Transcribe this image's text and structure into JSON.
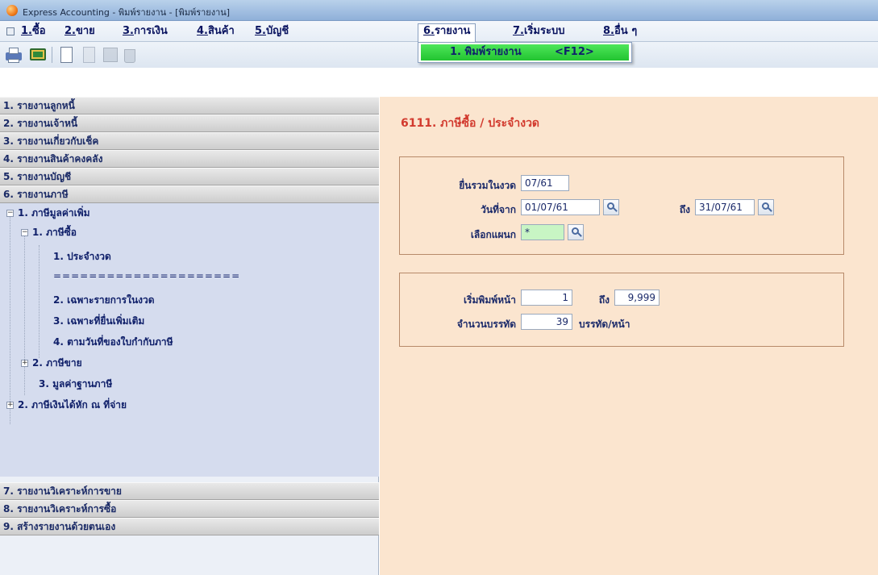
{
  "window": {
    "title": "Express Accounting - พิมพ์รายงาน - [พิมพ์รายงาน]"
  },
  "menu": {
    "items": [
      {
        "num": "1.",
        "label": "ซื้อ"
      },
      {
        "num": "2.",
        "label": "ขาย"
      },
      {
        "num": "3.",
        "label": "การเงิน"
      },
      {
        "num": "4.",
        "label": "สินค้า"
      },
      {
        "num": "5.",
        "label": "บัญชี"
      },
      {
        "num": "6.",
        "label": "รายงาน"
      },
      {
        "num": "7.",
        "label": "เริ่มระบบ"
      },
      {
        "num": "8.",
        "label": "อื่น ๆ"
      }
    ]
  },
  "dropdown": {
    "label": "1. พิมพ์รายงาน",
    "shortcut": "<F12>"
  },
  "nav": {
    "headers": [
      "1. รายงานลูกหนี้",
      "2. รายงานเจ้าหนี้",
      "3. รายงานเกี่ยวกับเช็ค",
      "4. รายงานสินค้าคงคลัง",
      "5. รายงานบัญชี",
      "6. รายงานภาษี",
      "7. รายงานวิเคราะห์การขาย",
      "8. รายงานวิเคราะห์การซื้อ",
      "9. สร้างรายงานด้วยตนเอง"
    ],
    "tree": {
      "vat": "1. ภาษีมูลค่าเพิ่ม",
      "purchase_tax": "1. ภาษีซื้อ",
      "per_period": "1. ประจำงวด",
      "separator": "=====================",
      "in_period": "2. เฉพาะรายการในงวด",
      "additional": "3. เฉพาะที่ยื่นเพิ่มเติม",
      "by_invoice_date": "4. ตามวันที่ของใบกำกับภาษี",
      "sales_tax": "2. ภาษีขาย",
      "tax_base": "3. มูลค่าฐานภาษี",
      "withholding": "2. ภาษีเงินได้หัก ณ ที่จ่าย"
    }
  },
  "report": {
    "title": "6111. ภาษีซื้อ / ประจำงวด",
    "period_label": "ยื่นรวมในงวด",
    "period_value": "07/61",
    "date_from_label": "วันที่จาก",
    "date_from_value": "01/07/61",
    "date_to_label": "ถึง",
    "date_to_value": "31/07/61",
    "dept_label": "เลือกแผนก",
    "dept_value": "*",
    "start_page_label": "เริ่มพิมพ์หน้า",
    "start_page_value": "1",
    "end_page_label": "ถึง",
    "end_page_value": "9,999",
    "lines_label": "จำนวนบรรทัด",
    "lines_value": "39",
    "lines_unit": "บรรทัด/หน้า"
  }
}
